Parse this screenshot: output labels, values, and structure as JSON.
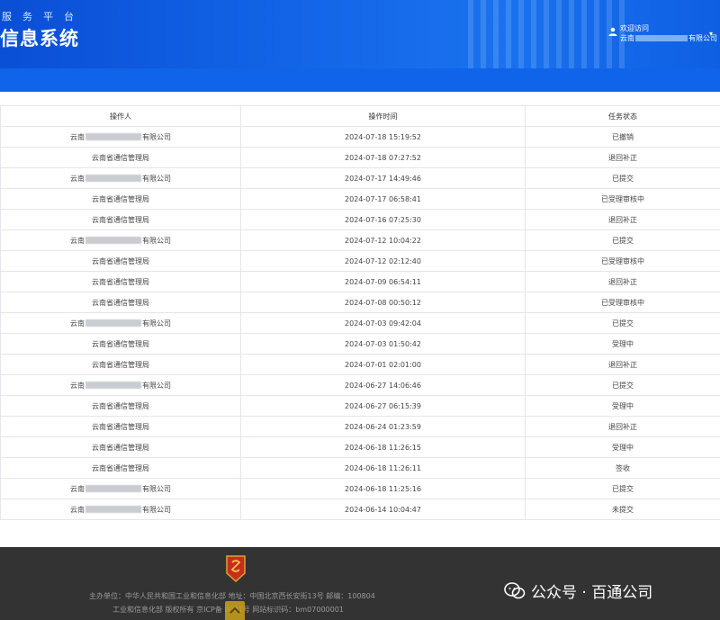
{
  "header": {
    "subtitle": "服务平台",
    "title": "信息系统",
    "user": {
      "greeting": "欢迎访问",
      "company_prefix": "云南",
      "company_suffix": "有限公司"
    }
  },
  "table": {
    "columns": [
      "操作人",
      "操作时间",
      "任务状态"
    ],
    "rows": [
      {
        "operator_prefix": "云南",
        "operator_suffix": "有限公司",
        "masked": true,
        "time": "2024-07-18 15:19:52",
        "status": "已撤销"
      },
      {
        "operator": "云南省通信管理局",
        "masked": false,
        "time": "2024-07-18 07:27:52",
        "status": "退回补正"
      },
      {
        "operator_prefix": "云南",
        "operator_suffix": "有限公司",
        "masked": true,
        "time": "2024-07-17 14:49:46",
        "status": "已提交"
      },
      {
        "operator": "云南省通信管理局",
        "masked": false,
        "time": "2024-07-17 06:58:41",
        "status": "已受理审核中"
      },
      {
        "operator": "云南省通信管理局",
        "masked": false,
        "time": "2024-07-16 07:25:30",
        "status": "退回补正"
      },
      {
        "operator_prefix": "云南",
        "operator_suffix": "有限公司",
        "masked": true,
        "time": "2024-07-12 10:04:22",
        "status": "已提交"
      },
      {
        "operator": "云南省通信管理局",
        "masked": false,
        "time": "2024-07-12 02:12:40",
        "status": "已受理审核中"
      },
      {
        "operator": "云南省通信管理局",
        "masked": false,
        "time": "2024-07-09 06:54:11",
        "status": "退回补正"
      },
      {
        "operator": "云南省通信管理局",
        "masked": false,
        "time": "2024-07-08 00:50:12",
        "status": "已受理审核中"
      },
      {
        "operator_prefix": "云南",
        "operator_suffix": "有限公司",
        "masked": true,
        "time": "2024-07-03 09:42:04",
        "status": "已提交"
      },
      {
        "operator": "云南省通信管理局",
        "masked": false,
        "time": "2024-07-03 01:50:42",
        "status": "受理中"
      },
      {
        "operator": "云南省通信管理局",
        "masked": false,
        "time": "2024-07-01 02:01:00",
        "status": "退回补正"
      },
      {
        "operator_prefix": "云南",
        "operator_suffix": "有限公司",
        "masked": true,
        "time": "2024-06-27 14:06:46",
        "status": "已提交"
      },
      {
        "operator": "云南省通信管理局",
        "masked": false,
        "time": "2024-06-27 06:15:39",
        "status": "受理中"
      },
      {
        "operator": "云南省通信管理局",
        "masked": false,
        "time": "2024-06-24 01:23:59",
        "status": "退回补正"
      },
      {
        "operator": "云南省通信管理局",
        "masked": false,
        "time": "2024-06-18 11:26:15",
        "status": "受理中"
      },
      {
        "operator": "云南省通信管理局",
        "masked": false,
        "time": "2024-06-18 11:26:11",
        "status": "签收"
      },
      {
        "operator_prefix": "云南",
        "operator_suffix": "有限公司",
        "masked": true,
        "time": "2024-06-18 11:25:16",
        "status": "已提交"
      },
      {
        "operator_prefix": "云南",
        "operator_suffix": "有限公司",
        "masked": true,
        "time": "2024-06-14 10:04:47",
        "status": "未提交"
      }
    ]
  },
  "footer": {
    "line1": "主办单位：中华人民共和国工业和信息化部 地址：中国北京西长安街13号 邮编：100804",
    "line2": "工业和信息化部 版权所有 京ICP备  0001号 网站标识码：bm07000001"
  },
  "watermark": {
    "text": "公众号 · 百通公司"
  },
  "colors": {
    "header_blue": "#1467e8",
    "footer_bg": "#333333",
    "border": "#e3e6ea"
  }
}
